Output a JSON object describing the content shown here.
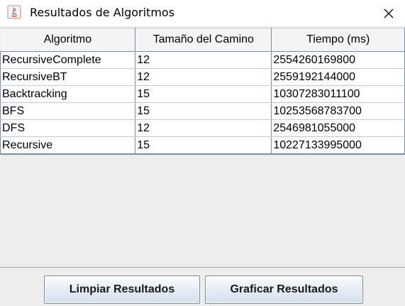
{
  "window": {
    "title": "Resultados de Algoritmos",
    "app_icon": "java-icon",
    "close_icon": "close-icon"
  },
  "table": {
    "headers": [
      "Algoritmo",
      "Tamaño del Camino",
      "Tiempo (ms)"
    ],
    "rows": [
      [
        "RecursiveComplete",
        "12",
        "2554260169800"
      ],
      [
        "RecursiveBT",
        "12",
        "2559192144000"
      ],
      [
        "Backtracking",
        "15",
        "10307283011100"
      ],
      [
        "BFS",
        "15",
        "10253568783700"
      ],
      [
        "DFS",
        "12",
        "2546981055000"
      ],
      [
        "Recursive",
        "15",
        "10227133995000"
      ]
    ]
  },
  "buttons": {
    "clear_label": "Limpiar Resultados",
    "graph_label": "Graficar Resultados"
  }
}
